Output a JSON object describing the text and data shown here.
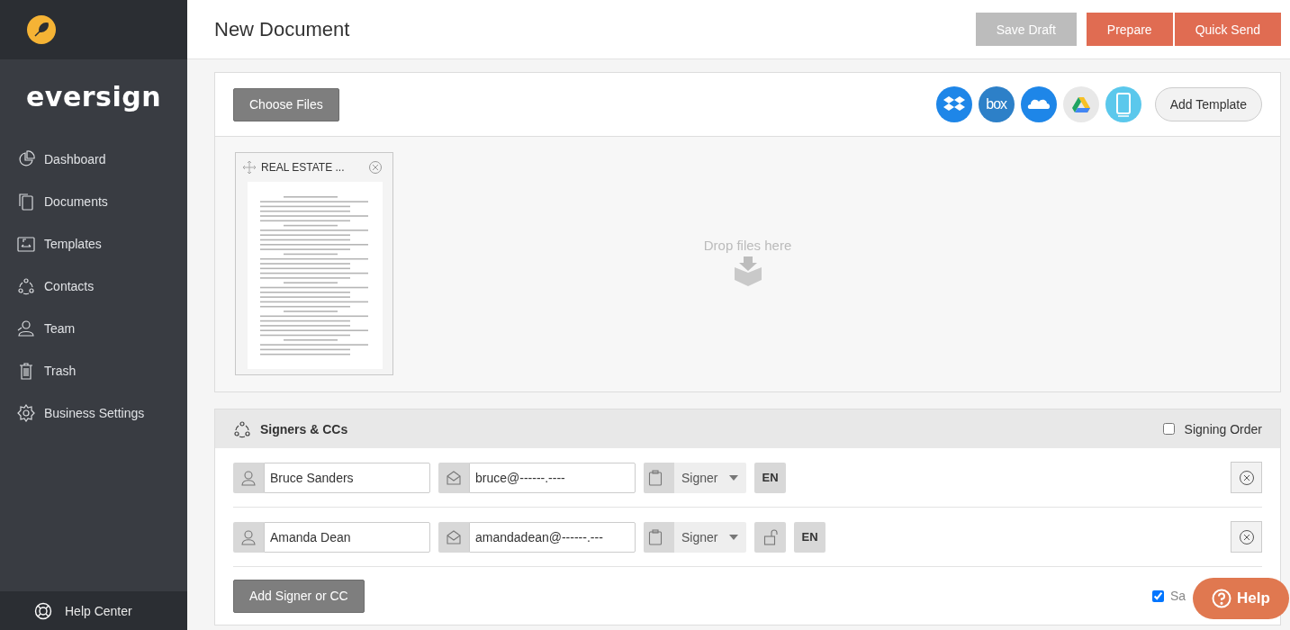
{
  "sidebar": {
    "brand": "eversign",
    "items": [
      {
        "label": "Dashboard",
        "kind": "pie"
      },
      {
        "label": "Documents",
        "kind": "docs"
      },
      {
        "label": "Templates",
        "kind": "template"
      },
      {
        "label": "Contacts",
        "kind": "contacts"
      },
      {
        "label": "Team",
        "kind": "team"
      },
      {
        "label": "Trash",
        "kind": "trash"
      },
      {
        "label": "Business Settings",
        "kind": "gear"
      }
    ],
    "footer": "Help Center"
  },
  "header": {
    "title": "New Document",
    "buttons": [
      {
        "label": "Save Draft",
        "kind": "muted"
      },
      {
        "label": "Prepare",
        "kind": "primary"
      },
      {
        "label": "Quick Send",
        "kind": "primary"
      }
    ]
  },
  "files": {
    "choose_button": "Choose Files",
    "sources": [
      {
        "kind": "dropbox"
      },
      {
        "kind": "box",
        "label": "box"
      },
      {
        "kind": "onedrive"
      },
      {
        "kind": "drive"
      },
      {
        "kind": "device"
      }
    ],
    "template_button": "Add Template",
    "documents": [
      {
        "name": "REAL ESTATE ..."
      }
    ],
    "drop_hint": "Drop files here"
  },
  "signers": {
    "title": "Signers & CCs",
    "signing_order": {
      "label": "Signing Order",
      "checked": false
    },
    "rows": [
      {
        "name": "Bruce Sanders",
        "email": "bruce@------.----",
        "role": "Signer",
        "lock_button": false,
        "language": "EN"
      },
      {
        "name": "Amanda Dean",
        "email": "amandadean@------.---",
        "role": "Signer",
        "lock_button": true,
        "language": "EN"
      }
    ],
    "add_button": "Add Signer or CC",
    "save_option": {
      "label": "Sa",
      "checked": true
    }
  },
  "help_button": "Help"
}
